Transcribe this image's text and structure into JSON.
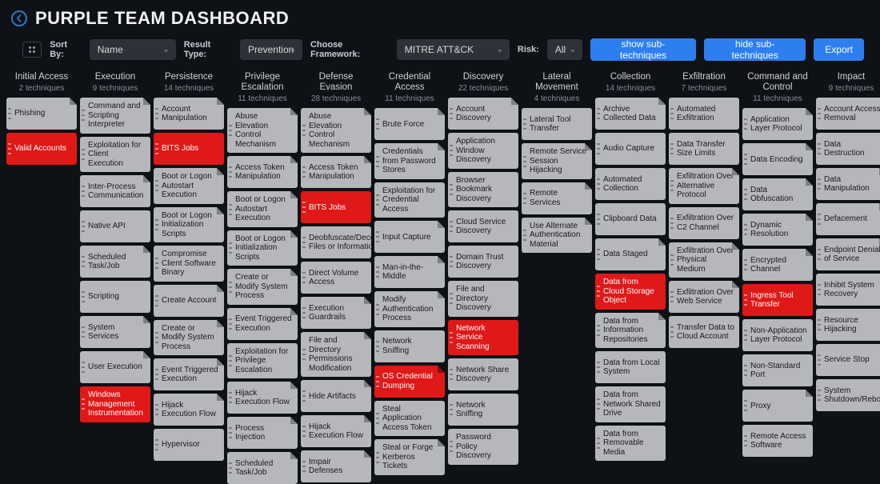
{
  "header": {
    "title": "PURPLE TEAM DASHBOARD"
  },
  "controls": {
    "sortByLabel": "Sort By:",
    "sortByValue": "Name",
    "resultTypeLabel": "Result Type:",
    "resultTypeValue": "Prevention",
    "frameworkLabel": "Choose Framework:",
    "frameworkValue": "MITRE ATT&CK",
    "riskLabel": "Risk:",
    "riskValue": "All",
    "showSub": "show sub-techniques",
    "hideSub": "hide sub-techniques",
    "export": "Export"
  },
  "columns": [
    {
      "title": "Initial Access",
      "sub": "2 techniques",
      "cells": [
        {
          "t": "Phishing",
          "c": 1
        },
        {
          "t": "Valid Accounts",
          "red": true
        }
      ]
    },
    {
      "title": "Execution",
      "sub": "9 techniques",
      "cells": [
        {
          "t": "Command and Scripting Interpreter",
          "c": 1
        },
        {
          "t": "Exploitation for Client Execution"
        },
        {
          "t": "Inter-Process Communication",
          "c": 1
        },
        {
          "t": "Native API"
        },
        {
          "t": "Scheduled Task/Job",
          "c": 1
        },
        {
          "t": "Scripting"
        },
        {
          "t": "System Services",
          "c": 1
        },
        {
          "t": "User Execution",
          "c": 1
        },
        {
          "t": "Windows Management Instrumentation",
          "red": true
        }
      ]
    },
    {
      "title": "Persistence",
      "sub": "14 techniques",
      "cells": [
        {
          "t": "Account Manipulation",
          "c": 1
        },
        {
          "t": "BITS Jobs",
          "red": true
        },
        {
          "t": "Boot or Logon Autostart Execution",
          "c": 1
        },
        {
          "t": "Boot or Logon Initialization Scripts",
          "c": 1
        },
        {
          "t": "Compromise Client Software Binary"
        },
        {
          "t": "Create Account",
          "c": 1
        },
        {
          "t": "Create or Modify System Process",
          "c": 1
        },
        {
          "t": "Event Triggered Execution",
          "c": 1
        },
        {
          "t": "Hijack Execution Flow",
          "c": 1
        },
        {
          "t": "Hypervisor"
        }
      ]
    },
    {
      "title": "Privilege Escalation",
      "sub": "11 techniques",
      "cells": [
        {
          "t": "Abuse Elevation Control Mechanism",
          "c": 1
        },
        {
          "t": "Access Token Manipulation",
          "c": 1
        },
        {
          "t": "Boot or Logon Autostart Execution",
          "c": 1
        },
        {
          "t": "Boot or Logon Initialization Scripts",
          "c": 1
        },
        {
          "t": "Create or Modify System Process",
          "c": 1
        },
        {
          "t": "Event Triggered Execution",
          "c": 1
        },
        {
          "t": "Exploitation for Privilege Escalation"
        },
        {
          "t": "Hijack Execution Flow",
          "c": 1
        },
        {
          "t": "Process Injection",
          "c": 1
        },
        {
          "t": "Scheduled Task/Job",
          "c": 1
        }
      ]
    },
    {
      "title": "Defense Evasion",
      "sub": "28 techniques",
      "cells": [
        {
          "t": "Abuse Elevation Control Mechanism",
          "c": 1
        },
        {
          "t": "Access Token Manipulation",
          "c": 1
        },
        {
          "t": "BITS Jobs",
          "red": true
        },
        {
          "t": "Deobfuscate/Decode Files or Information"
        },
        {
          "t": "Direct Volume Access"
        },
        {
          "t": "Execution Guardrails",
          "c": 1
        },
        {
          "t": "File and Directory Permissions Modification",
          "c": 1
        },
        {
          "t": "Hide Artifacts",
          "c": 1
        },
        {
          "t": "Hijack Execution Flow",
          "c": 1
        },
        {
          "t": "Impair Defenses",
          "c": 1
        }
      ]
    },
    {
      "title": "Credential Access",
      "sub": "11 techniques",
      "cells": [
        {
          "t": "Brute Force",
          "c": 1
        },
        {
          "t": "Credentials from Password Stores",
          "c": 1
        },
        {
          "t": "Exploitation for Credential Access"
        },
        {
          "t": "Input Capture",
          "c": 1
        },
        {
          "t": "Man-in-the-Middle",
          "c": 1
        },
        {
          "t": "Modify Authentication Process",
          "c": 1
        },
        {
          "t": "Network Sniffing"
        },
        {
          "t": "OS Credential Dumping",
          "red": true,
          "c": 1
        },
        {
          "t": "Steal Application Access Token"
        },
        {
          "t": "Steal or Forge Kerberos Tickets",
          "c": 1
        }
      ]
    },
    {
      "title": "Discovery",
      "sub": "22 techniques",
      "cells": [
        {
          "t": "Account Discovery",
          "c": 1
        },
        {
          "t": "Application Window Discovery"
        },
        {
          "t": "Browser Bookmark Discovery"
        },
        {
          "t": "Cloud Service Discovery"
        },
        {
          "t": "Domain Trust Discovery"
        },
        {
          "t": "File and Directory Discovery"
        },
        {
          "t": "Network Service Scanning",
          "red": true
        },
        {
          "t": "Network Share Discovery"
        },
        {
          "t": "Network Sniffing"
        },
        {
          "t": "Password Policy Discovery"
        }
      ]
    },
    {
      "title": "Lateral Movement",
      "sub": "4 techniques",
      "cells": [
        {
          "t": "Lateral Tool Transfer"
        },
        {
          "t": "Remote Service Session Hijacking",
          "c": 1
        },
        {
          "t": "Remote Services",
          "c": 1
        },
        {
          "t": "Use Alternate Authentication Material",
          "c": 1
        }
      ]
    },
    {
      "title": "Collection",
      "sub": "14 techniques",
      "cells": [
        {
          "t": "Archive Collected Data",
          "c": 1
        },
        {
          "t": "Audio Capture"
        },
        {
          "t": "Automated Collection"
        },
        {
          "t": "Clipboard Data"
        },
        {
          "t": "Data Staged",
          "c": 1
        },
        {
          "t": "Data from Cloud Storage Object",
          "red": true
        },
        {
          "t": "Data from Information Repositories",
          "c": 1
        },
        {
          "t": "Data from Local System"
        },
        {
          "t": "Data from Network Shared Drive"
        },
        {
          "t": "Data from Removable Media"
        }
      ]
    },
    {
      "title": "Exfiltration",
      "sub": "7 techniques",
      "cells": [
        {
          "t": "Automated Exfiltration"
        },
        {
          "t": "Data Transfer Size Limits"
        },
        {
          "t": "Exfiltration Over Alternative Protocol",
          "c": 1
        },
        {
          "t": "Exfiltration Over C2 Channel"
        },
        {
          "t": "Exfiltration Over Physical Medium",
          "c": 1
        },
        {
          "t": "Exfiltration Over Web Service",
          "c": 1
        },
        {
          "t": "Transfer Data to Cloud Account"
        }
      ]
    },
    {
      "title": "Command and Control",
      "sub": "11 techniques",
      "cells": [
        {
          "t": "Application Layer Protocol",
          "c": 1
        },
        {
          "t": "Data Encoding",
          "c": 1
        },
        {
          "t": "Data Obfuscation",
          "c": 1
        },
        {
          "t": "Dynamic Resolution",
          "c": 1
        },
        {
          "t": "Encrypted Channel",
          "c": 1
        },
        {
          "t": "Ingress Tool Transfer",
          "red": true
        },
        {
          "t": "Non-Application Layer Protocol"
        },
        {
          "t": "Non-Standard Port"
        },
        {
          "t": "Proxy",
          "c": 1
        },
        {
          "t": "Remote Access Software"
        }
      ]
    },
    {
      "title": "Impact",
      "sub": "9 techniques",
      "cells": [
        {
          "t": "Account Access Removal"
        },
        {
          "t": "Data Destruction"
        },
        {
          "t": "Data Manipulation",
          "c": 1
        },
        {
          "t": "Defacement",
          "c": 1
        },
        {
          "t": "Endpoint Denial of Service",
          "c": 1
        },
        {
          "t": "Inhibit System Recovery"
        },
        {
          "t": "Resource Hijacking"
        },
        {
          "t": "Service Stop"
        },
        {
          "t": "System Shutdown/Reboot"
        }
      ]
    }
  ]
}
